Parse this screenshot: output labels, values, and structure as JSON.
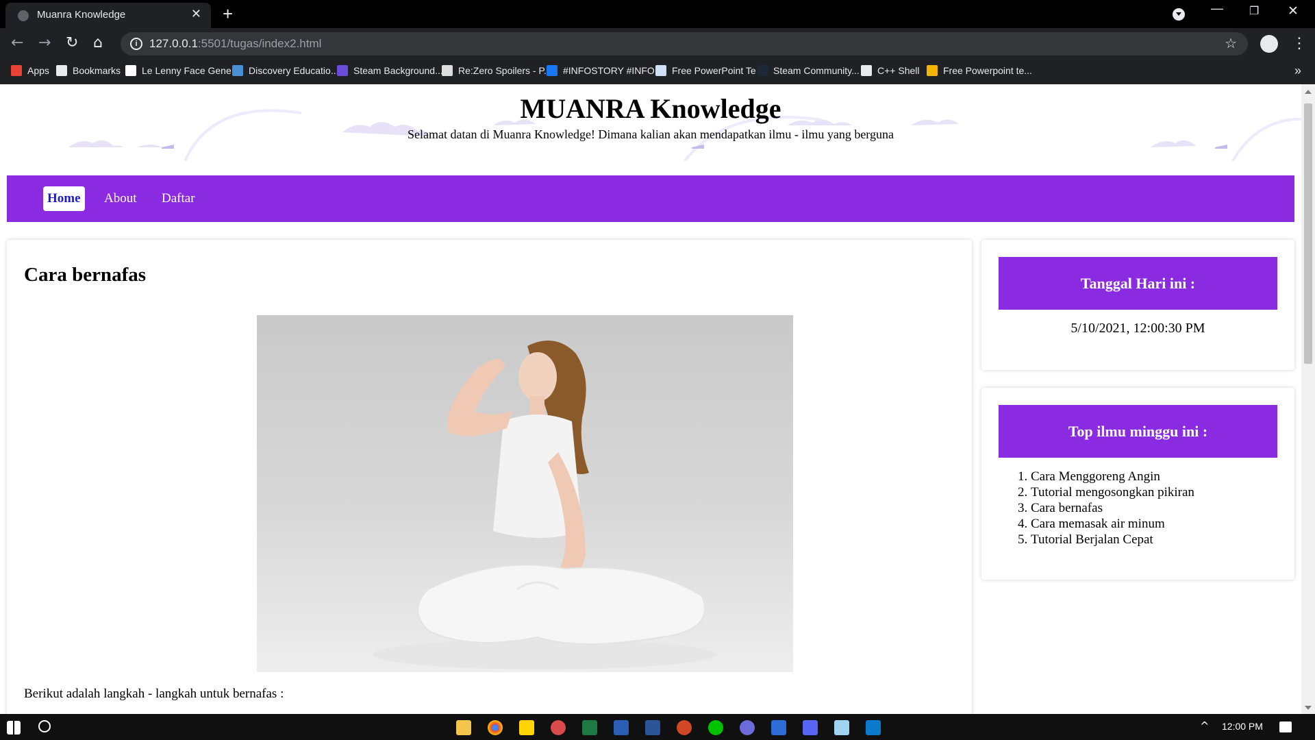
{
  "browser": {
    "tab_title": "Muanra Knowledge",
    "tab_close": "✕",
    "new_tab": "+",
    "url_host": "127.0.0.1",
    "url_rest": ":5501/tugas/index2.html",
    "info_glyph": "i",
    "bookmarks": [
      {
        "label": "Apps",
        "icon": "apps-grid-icon",
        "color": "#ea4335"
      },
      {
        "label": "Bookmarks",
        "icon": "star-icon",
        "color": "#e8eaed"
      },
      {
        "label": "Le Lenny Face Gene...",
        "icon": "lenny-face-icon",
        "color": "#ffffff"
      },
      {
        "label": "Discovery Educatio...",
        "icon": "globe-icon",
        "color": "#4a8fd4"
      },
      {
        "label": "Steam Background...",
        "icon": "steam-bg-icon",
        "color": "#6a4cd9"
      },
      {
        "label": "Re:Zero Spoilers - P...",
        "icon": "grid-icon",
        "color": "#dddddd"
      },
      {
        "label": "#INFOSTORY #INFO...",
        "icon": "facebook-icon",
        "color": "#1877f2"
      },
      {
        "label": "Free PowerPoint Te...",
        "icon": "page-icon",
        "color": "#cfe0f5"
      },
      {
        "label": "Steam Community...",
        "icon": "steam-icon",
        "color": "#1b2838"
      },
      {
        "label": "C++ Shell",
        "icon": "shell-icon",
        "color": "#e8eaed"
      },
      {
        "label": "Free Powerpoint te...",
        "icon": "folder-icon",
        "color": "#f4b400"
      }
    ],
    "bookmarks_more": "»"
  },
  "site": {
    "title": "MUANRA Knowledge",
    "subtitle": "Selamat datan di Muanra Knowledge! Dimana kalian akan mendapatkan ilmu - ilmu yang berguna",
    "nav": [
      "Home",
      "About",
      "Daftar"
    ],
    "nav_active": "Home",
    "accent_color": "#8a2be2"
  },
  "article": {
    "title": "Cara bernafas",
    "image_alt": "woman doing breathing exercise",
    "intro": "Berikut adalah langkah - langkah untuk bernafas :"
  },
  "sidebar": {
    "date_heading": "Tanggal Hari ini :",
    "datetime": "5/10/2021, 12:00:30 PM",
    "top_heading": "Top ilmu minggu ini :",
    "top_list": [
      "Cara Menggoreng Angin",
      "Tutorial mengosongkan pikiran",
      "Cara bernafas",
      "Cara memasak air minum",
      "Tutorial Berjalan Cepat"
    ]
  },
  "taskbar": {
    "time": "12:00 PM"
  }
}
